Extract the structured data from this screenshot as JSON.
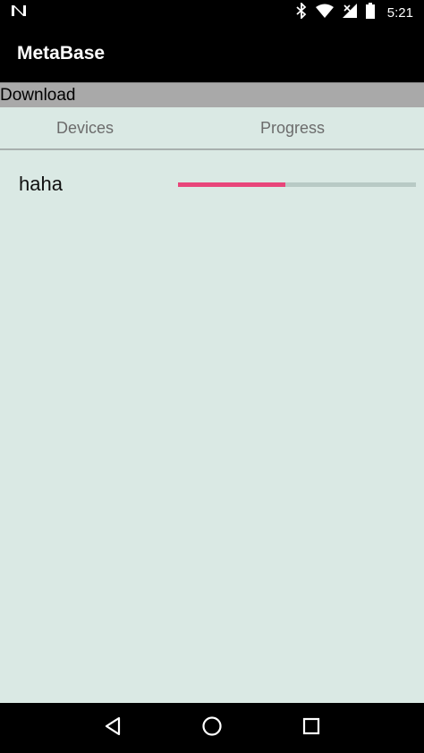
{
  "status_bar": {
    "time": "5:21",
    "icons": [
      "notification-n-icon",
      "bluetooth-icon",
      "wifi-icon",
      "signal-icon",
      "battery-icon"
    ]
  },
  "toolbar": {
    "title": "MetaBase"
  },
  "section": {
    "header": "Download"
  },
  "table": {
    "columns": [
      "Devices",
      "Progress"
    ],
    "rows": [
      {
        "device": "haha",
        "progress": 0.45
      }
    ]
  },
  "nav_bar": {
    "icons": [
      "back-icon",
      "home-icon",
      "recents-icon"
    ]
  },
  "colors": {
    "accent": "#e8457a",
    "background": "#dae9e4",
    "section_header": "#a9a9a9"
  }
}
